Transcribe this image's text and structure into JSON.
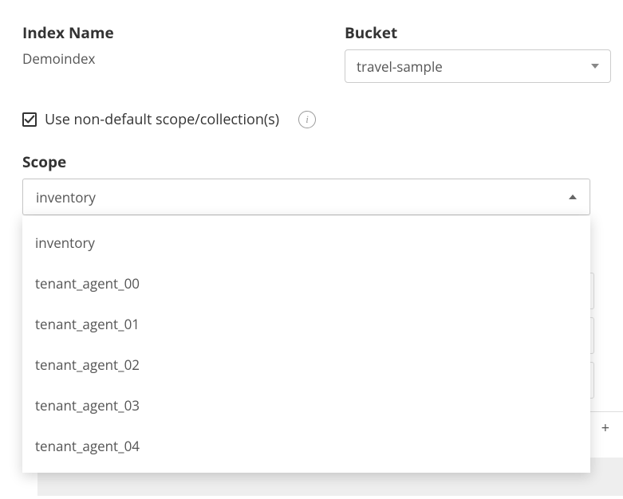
{
  "index": {
    "label": "Index Name",
    "value": "Demoindex"
  },
  "bucket": {
    "label": "Bucket",
    "selected": "travel-sample"
  },
  "nondefault": {
    "label": "Use non-default scope/collection(s)",
    "info_glyph": "i"
  },
  "scope": {
    "label": "Scope",
    "selected": "inventory",
    "options": [
      "inventory",
      "tenant_agent_00",
      "tenant_agent_01",
      "tenant_agent_02",
      "tenant_agent_03",
      "tenant_agent_04"
    ]
  },
  "add_glyph": "+"
}
